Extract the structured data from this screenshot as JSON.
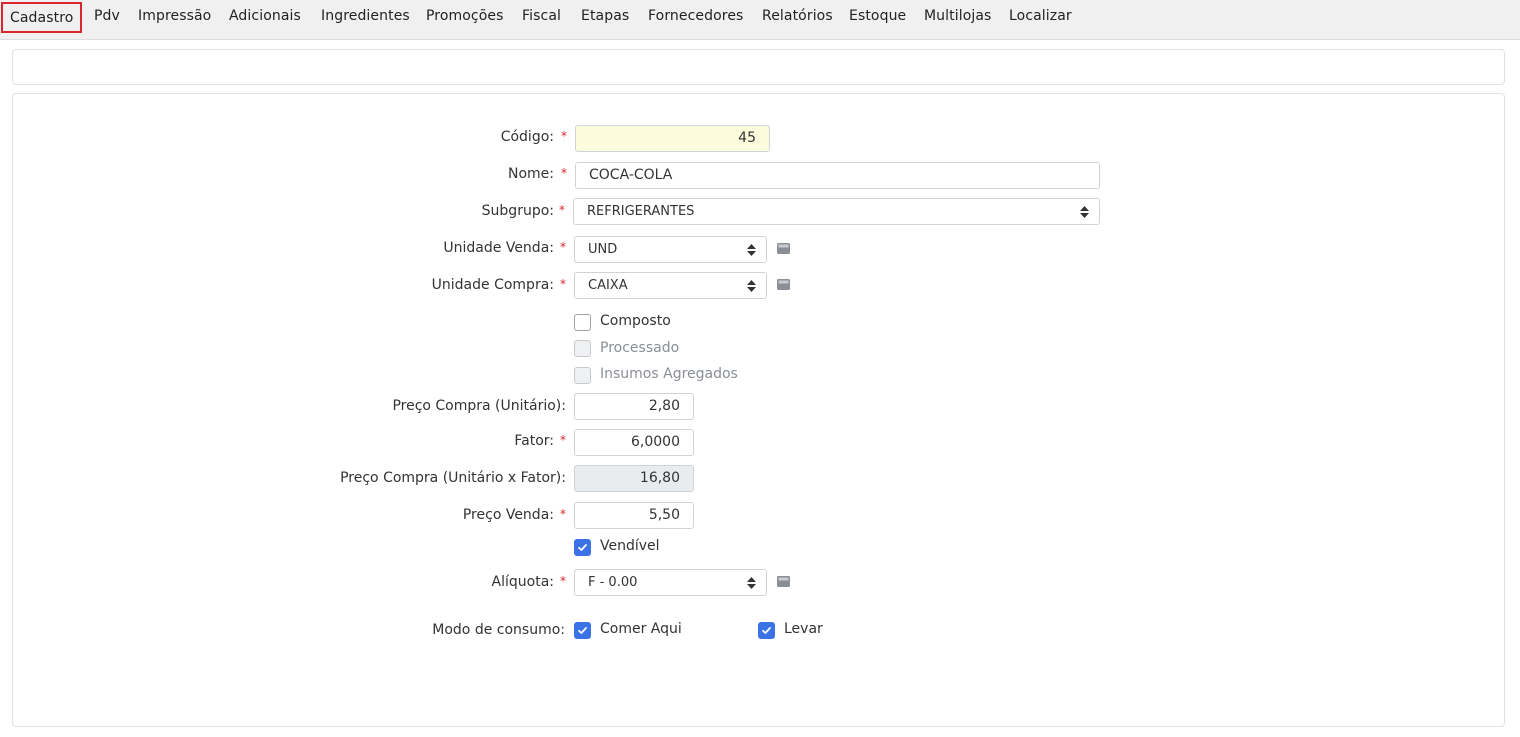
{
  "tabs": [
    {
      "label": "Cadastro",
      "active": true
    },
    {
      "label": "Pdv"
    },
    {
      "label": "Impressão"
    },
    {
      "label": "Adicionais"
    },
    {
      "label": "Ingredientes"
    },
    {
      "label": "Promoções"
    },
    {
      "label": "Fiscal"
    },
    {
      "label": "Etapas"
    },
    {
      "label": "Fornecedores"
    },
    {
      "label": "Relatórios"
    },
    {
      "label": "Estoque"
    },
    {
      "label": "Multilojas"
    },
    {
      "label": "Localizar"
    }
  ],
  "form": {
    "required_mark": "*",
    "codigo": {
      "label": "Código:",
      "value": "45"
    },
    "nome": {
      "label": "Nome:",
      "value": "COCA-COLA"
    },
    "subgrupo": {
      "label": "Subgrupo:",
      "value": "REFRIGERANTES"
    },
    "unidade_venda": {
      "label": "Unidade Venda:",
      "value": "UND"
    },
    "unidade_compra": {
      "label": "Unidade Compra:",
      "value": "CAIXA"
    },
    "composto": {
      "label": "Composto",
      "checked": false
    },
    "processado": {
      "label": "Processado",
      "checked": false,
      "disabled": true
    },
    "insumos": {
      "label": "Insumos Agregados",
      "checked": false,
      "disabled": true
    },
    "preco_compra_unit": {
      "label": "Preço Compra (Unitário):",
      "value": "2,80"
    },
    "fator": {
      "label": "Fator:",
      "value": "6,0000"
    },
    "preco_compra_fator": {
      "label": "Preço Compra (Unitário x Fator):",
      "value": "16,80"
    },
    "preco_venda": {
      "label": "Preço Venda:",
      "value": "5,50"
    },
    "vendivel": {
      "label": "Vendível",
      "checked": true
    },
    "aliquota": {
      "label": "Alíquota:",
      "value": "F - 0.00"
    },
    "modo_consumo": {
      "label": "Modo de consumo:",
      "comer_aqui": {
        "label": "Comer Aqui",
        "checked": true
      },
      "levar": {
        "label": "Levar",
        "checked": true
      }
    }
  },
  "colors": {
    "accent": "#3b72e6",
    "active_tab_border": "#d9262c",
    "code_bg": "#fcfbdc"
  }
}
